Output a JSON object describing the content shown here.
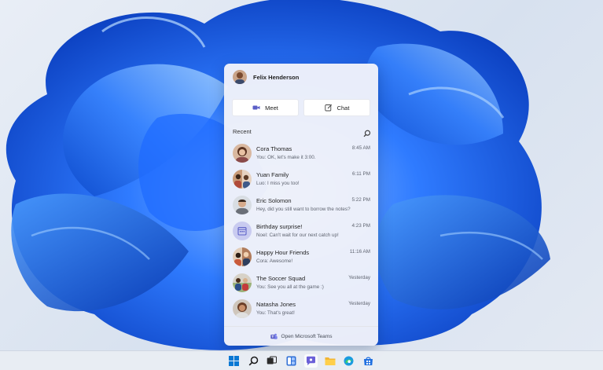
{
  "user": {
    "name": "Felix Henderson"
  },
  "actions": [
    {
      "label": "Meet",
      "icon": "video-camera-icon"
    },
    {
      "label": "Chat",
      "icon": "compose-icon"
    }
  ],
  "recent": {
    "title": "Recent",
    "search_icon": "search-icon"
  },
  "conversations": [
    {
      "name": "Cora Thomas",
      "message": "You: OK, let's make it 3:00.",
      "time": "8:45 AM"
    },
    {
      "name": "Yuan Family",
      "message": "Luo: I miss you too!",
      "time": "6:11 PM"
    },
    {
      "name": "Eric Solomon",
      "message": "Hey, did you still want to borrow the notes?",
      "time": "5:22 PM"
    },
    {
      "name": "Birthday surprise!",
      "message": "Noel: Can't wait for our next catch up!",
      "time": "4:23 PM"
    },
    {
      "name": "Happy Hour Friends",
      "message": "Cora: Awesome!",
      "time": "11:16 AM"
    },
    {
      "name": "The Soccer Squad",
      "message": "You: See you all at the game :)",
      "time": "Yesterday"
    },
    {
      "name": "Natasha Jones",
      "message": "You: That's great!",
      "time": "Yesterday"
    }
  ],
  "footer": {
    "label": "Open Microsoft Teams",
    "icon": "teams-icon"
  },
  "taskbar": {
    "icons": [
      "windows-start-icon",
      "search-icon",
      "task-view-icon",
      "widgets-icon",
      "chat-icon",
      "file-explorer-icon",
      "edge-browser-icon",
      "microsoft-store-icon"
    ],
    "active": "chat-icon"
  },
  "colors": {
    "accent": "#5b5fc7",
    "wallpaper_blue": "#1a5fe0",
    "panel_bg": "#f1f3fa"
  }
}
